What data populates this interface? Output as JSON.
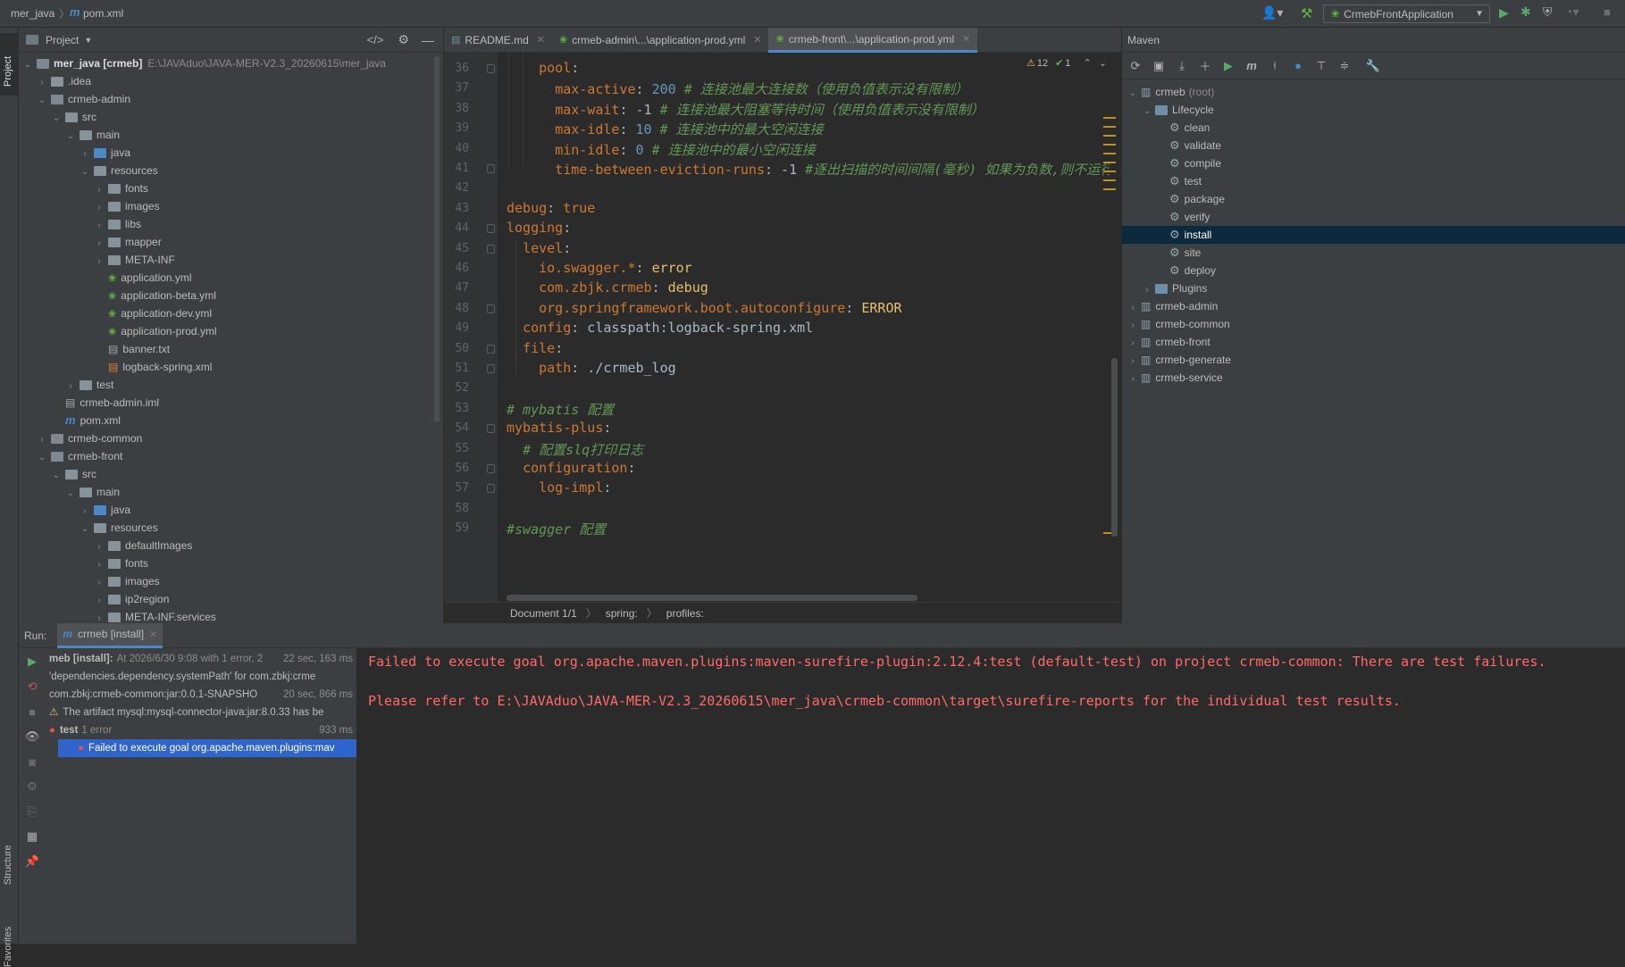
{
  "topbar": {
    "breadcrumb_project": "mer_java",
    "breadcrumb_file": "pom.xml",
    "run_config": "CrmebFrontApplication"
  },
  "leftstrip": {
    "project": "Project",
    "structure": "Structure",
    "favorites": "Favorites"
  },
  "project": {
    "title": "Project",
    "rows": [
      {
        "label": "mer_java [crmeb]",
        "path": "E:\\JAVAduo\\JAVA-MER-V2.3_20260615\\mer_java",
        "depth": 0,
        "arrow": "open",
        "icon": "module-folder-icon"
      },
      {
        "label": ".idea",
        "depth": 1,
        "arrow": "closed",
        "icon": "folder-icon"
      },
      {
        "label": "crmeb-admin",
        "depth": 1,
        "arrow": "open",
        "icon": "module-folder-icon"
      },
      {
        "label": "src",
        "depth": 2,
        "arrow": "open",
        "icon": "folder-icon"
      },
      {
        "label": "main",
        "depth": 3,
        "arrow": "open",
        "icon": "folder-icon"
      },
      {
        "label": "java",
        "depth": 4,
        "arrow": "closed",
        "icon": "source-folder-icon"
      },
      {
        "label": "resources",
        "depth": 4,
        "arrow": "open",
        "icon": "resources-folder-icon"
      },
      {
        "label": "fonts",
        "depth": 5,
        "arrow": "closed",
        "icon": "folder-icon"
      },
      {
        "label": "images",
        "depth": 5,
        "arrow": "closed",
        "icon": "folder-icon"
      },
      {
        "label": "libs",
        "depth": 5,
        "arrow": "closed",
        "icon": "folder-icon"
      },
      {
        "label": "mapper",
        "depth": 5,
        "arrow": "closed",
        "icon": "folder-icon"
      },
      {
        "label": "META-INF",
        "depth": 5,
        "arrow": "closed",
        "icon": "folder-icon"
      },
      {
        "label": "application.yml",
        "depth": 5,
        "arrow": "none",
        "icon": "yaml-file-icon"
      },
      {
        "label": "application-beta.yml",
        "depth": 5,
        "arrow": "none",
        "icon": "yaml-file-icon"
      },
      {
        "label": "application-dev.yml",
        "depth": 5,
        "arrow": "none",
        "icon": "yaml-file-icon"
      },
      {
        "label": "application-prod.yml",
        "depth": 5,
        "arrow": "none",
        "icon": "yaml-file-icon"
      },
      {
        "label": "banner.txt",
        "depth": 5,
        "arrow": "none",
        "icon": "text-file-icon"
      },
      {
        "label": "logback-spring.xml",
        "depth": 5,
        "arrow": "none",
        "icon": "xml-file-icon"
      },
      {
        "label": "test",
        "depth": 3,
        "arrow": "closed",
        "icon": "folder-icon"
      },
      {
        "label": "crmeb-admin.iml",
        "depth": 2,
        "arrow": "none",
        "icon": "iml-file-icon"
      },
      {
        "label": "pom.xml",
        "depth": 2,
        "arrow": "none",
        "icon": "maven-file-icon"
      },
      {
        "label": "crmeb-common",
        "depth": 1,
        "arrow": "closed",
        "icon": "module-folder-icon"
      },
      {
        "label": "crmeb-front",
        "depth": 1,
        "arrow": "open",
        "icon": "module-folder-icon"
      },
      {
        "label": "src",
        "depth": 2,
        "arrow": "open",
        "icon": "folder-icon"
      },
      {
        "label": "main",
        "depth": 3,
        "arrow": "open",
        "icon": "folder-icon"
      },
      {
        "label": "java",
        "depth": 4,
        "arrow": "closed",
        "icon": "source-folder-icon"
      },
      {
        "label": "resources",
        "depth": 4,
        "arrow": "open",
        "icon": "resources-folder-icon"
      },
      {
        "label": "defaultImages",
        "depth": 5,
        "arrow": "closed",
        "icon": "folder-icon"
      },
      {
        "label": "fonts",
        "depth": 5,
        "arrow": "closed",
        "icon": "folder-icon"
      },
      {
        "label": "images",
        "depth": 5,
        "arrow": "closed",
        "icon": "folder-icon"
      },
      {
        "label": "ip2region",
        "depth": 5,
        "arrow": "closed",
        "icon": "folder-icon"
      },
      {
        "label": "META-INF.services",
        "depth": 5,
        "arrow": "closed",
        "icon": "folder-icon"
      }
    ]
  },
  "editor": {
    "tabs": [
      {
        "label": "README.md",
        "active": false
      },
      {
        "label": "crmeb-admin\\...\\application-prod.yml",
        "active": false
      },
      {
        "label": "crmeb-front\\...\\application-prod.yml",
        "active": true
      }
    ],
    "inspections": {
      "warnings": "12",
      "ok": "1"
    },
    "lines": [
      {
        "n": "36",
        "html": "    <span class=\"k\">pool</span>:"
      },
      {
        "n": "37",
        "html": "      <span class=\"k\">max-active</span>: <span class=\"num\">200</span> <span class=\"cm\"># 连接池最大连接数（使用负值表示没有限制）</span>"
      },
      {
        "n": "38",
        "html": "      <span class=\"k\">max-wait</span>: -1 <span class=\"cm\"># 连接池最大阻塞等待时间（使用负值表示没有限制）</span>"
      },
      {
        "n": "39",
        "html": "      <span class=\"k\">max-idle</span>: <span class=\"num\">10</span> <span class=\"cm\"># 连接池中的最大空闲连接</span>"
      },
      {
        "n": "40",
        "html": "      <span class=\"k\">min-idle</span>: <span class=\"num\">0</span> <span class=\"cm\"># 连接池中的最小空闲连接</span>"
      },
      {
        "n": "41",
        "html": "      <span class=\"k\">time-between-eviction-runs</span>: -1 <span class=\"cm\">#逐出扫描的时间间隔(毫秒) 如果为负数,则不运行逐出线程</span>"
      },
      {
        "n": "42",
        "html": ""
      },
      {
        "n": "43",
        "html": "<span class=\"k\">debug</span>: <span class=\"bool\">true</span>"
      },
      {
        "n": "44",
        "html": "<span class=\"k\">logging</span>:"
      },
      {
        "n": "45",
        "html": "  <span class=\"k\">level</span>:"
      },
      {
        "n": "46",
        "html": "    <span class=\"k\">io.swagger.*</span>: <span class=\"err\">error</span>"
      },
      {
        "n": "47",
        "html": "    <span class=\"k\">com.zbjk.crmeb</span>: <span class=\"err\">debug</span>"
      },
      {
        "n": "48",
        "html": "    <span class=\"k\">org.springframework.boot.autoconfigure</span>: <span class=\"err\">ERROR</span>"
      },
      {
        "n": "49",
        "html": "  <span class=\"k\">config</span>: classpath:logback-spring.xml"
      },
      {
        "n": "50",
        "html": "  <span class=\"k\">file</span>:"
      },
      {
        "n": "51",
        "html": "    <span class=\"k\">path</span>: ./crmeb_log"
      },
      {
        "n": "52",
        "html": ""
      },
      {
        "n": "53",
        "html": "<span class=\"cm\"># mybatis 配置</span>"
      },
      {
        "n": "54",
        "html": "<span class=\"k\">mybatis-plus</span>:"
      },
      {
        "n": "55",
        "html": "  <span class=\"cm\"># 配置slq打印日志</span>"
      },
      {
        "n": "56",
        "html": "  <span class=\"k\">configuration</span>:"
      },
      {
        "n": "57",
        "html": "    <span class=\"k\">log-impl</span>:"
      },
      {
        "n": "58",
        "html": ""
      },
      {
        "n": "59",
        "html": "<span class=\"cm\">#swagger 配置</span>"
      }
    ],
    "breadcrumb": [
      "Document 1/1",
      "spring:",
      "profiles:"
    ]
  },
  "maven": {
    "title": "Maven",
    "rows": [
      {
        "label": "crmeb",
        "suffix": "(root)",
        "depth": 0,
        "arrow": "open",
        "icon": "maven-module-icon"
      },
      {
        "label": "Lifecycle",
        "depth": 1,
        "arrow": "open",
        "icon": "lifecycle-folder-icon"
      },
      {
        "label": "clean",
        "depth": 2,
        "arrow": "none",
        "icon": "gear-icon"
      },
      {
        "label": "validate",
        "depth": 2,
        "arrow": "none",
        "icon": "gear-icon"
      },
      {
        "label": "compile",
        "depth": 2,
        "arrow": "none",
        "icon": "gear-icon"
      },
      {
        "label": "test",
        "depth": 2,
        "arrow": "none",
        "icon": "gear-icon"
      },
      {
        "label": "package",
        "depth": 2,
        "arrow": "none",
        "icon": "gear-icon"
      },
      {
        "label": "verify",
        "depth": 2,
        "arrow": "none",
        "icon": "gear-icon"
      },
      {
        "label": "install",
        "depth": 2,
        "arrow": "none",
        "icon": "gear-icon",
        "selected": true
      },
      {
        "label": "site",
        "depth": 2,
        "arrow": "none",
        "icon": "gear-icon"
      },
      {
        "label": "deploy",
        "depth": 2,
        "arrow": "none",
        "icon": "gear-icon"
      },
      {
        "label": "Plugins",
        "depth": 1,
        "arrow": "closed",
        "icon": "plugins-folder-icon"
      },
      {
        "label": "crmeb-admin",
        "depth": 0,
        "arrow": "closed",
        "icon": "maven-module-icon"
      },
      {
        "label": "crmeb-common",
        "depth": 0,
        "arrow": "closed",
        "icon": "maven-module-icon"
      },
      {
        "label": "crmeb-front",
        "depth": 0,
        "arrow": "closed",
        "icon": "maven-module-icon"
      },
      {
        "label": "crmeb-generate",
        "depth": 0,
        "arrow": "closed",
        "icon": "maven-module-icon"
      },
      {
        "label": "crmeb-service",
        "depth": 0,
        "arrow": "closed",
        "icon": "maven-module-icon"
      }
    ]
  },
  "run": {
    "label": "Run:",
    "tab": "crmeb [install]",
    "tree": [
      {
        "label": "meb [install]:",
        "extra": "At 2026/6/30 9:08 with 1 error, 2",
        "time": "22 sec, 163 ms",
        "status": "none",
        "depth": 0,
        "selected": false
      },
      {
        "label": "'dependencies.dependency.systemPath' for com.zbkj:crme",
        "time": "",
        "status": "none",
        "depth": 0,
        "selected": false
      },
      {
        "label": "com.zbkj:crmeb-common:jar:0.0.1-SNAPSHO",
        "time": "20 sec, 866 ms",
        "status": "none",
        "depth": 0,
        "selected": false
      },
      {
        "label": "The artifact mysql:mysql-connector-java:jar:8.0.33 has be",
        "time": "",
        "status": "warning",
        "depth": 0,
        "selected": false
      },
      {
        "label": "test",
        "extra": "1 error",
        "time": "933 ms",
        "status": "error",
        "depth": 0,
        "selected": false
      },
      {
        "label": "Failed to execute goal org.apache.maven.plugins:mav",
        "time": "",
        "status": "error",
        "depth": 1,
        "selected": true
      }
    ],
    "console": [
      "Failed to execute goal org.apache.maven.plugins:maven-surefire-plugin:2.12.4:test (default-test) on project crmeb-common: There are test failures.",
      "",
      "Please refer to E:\\JAVAduo\\JAVA-MER-V2.3_20260615\\mer_java\\crmeb-common\\target\\surefire-reports for the individual test results."
    ]
  }
}
